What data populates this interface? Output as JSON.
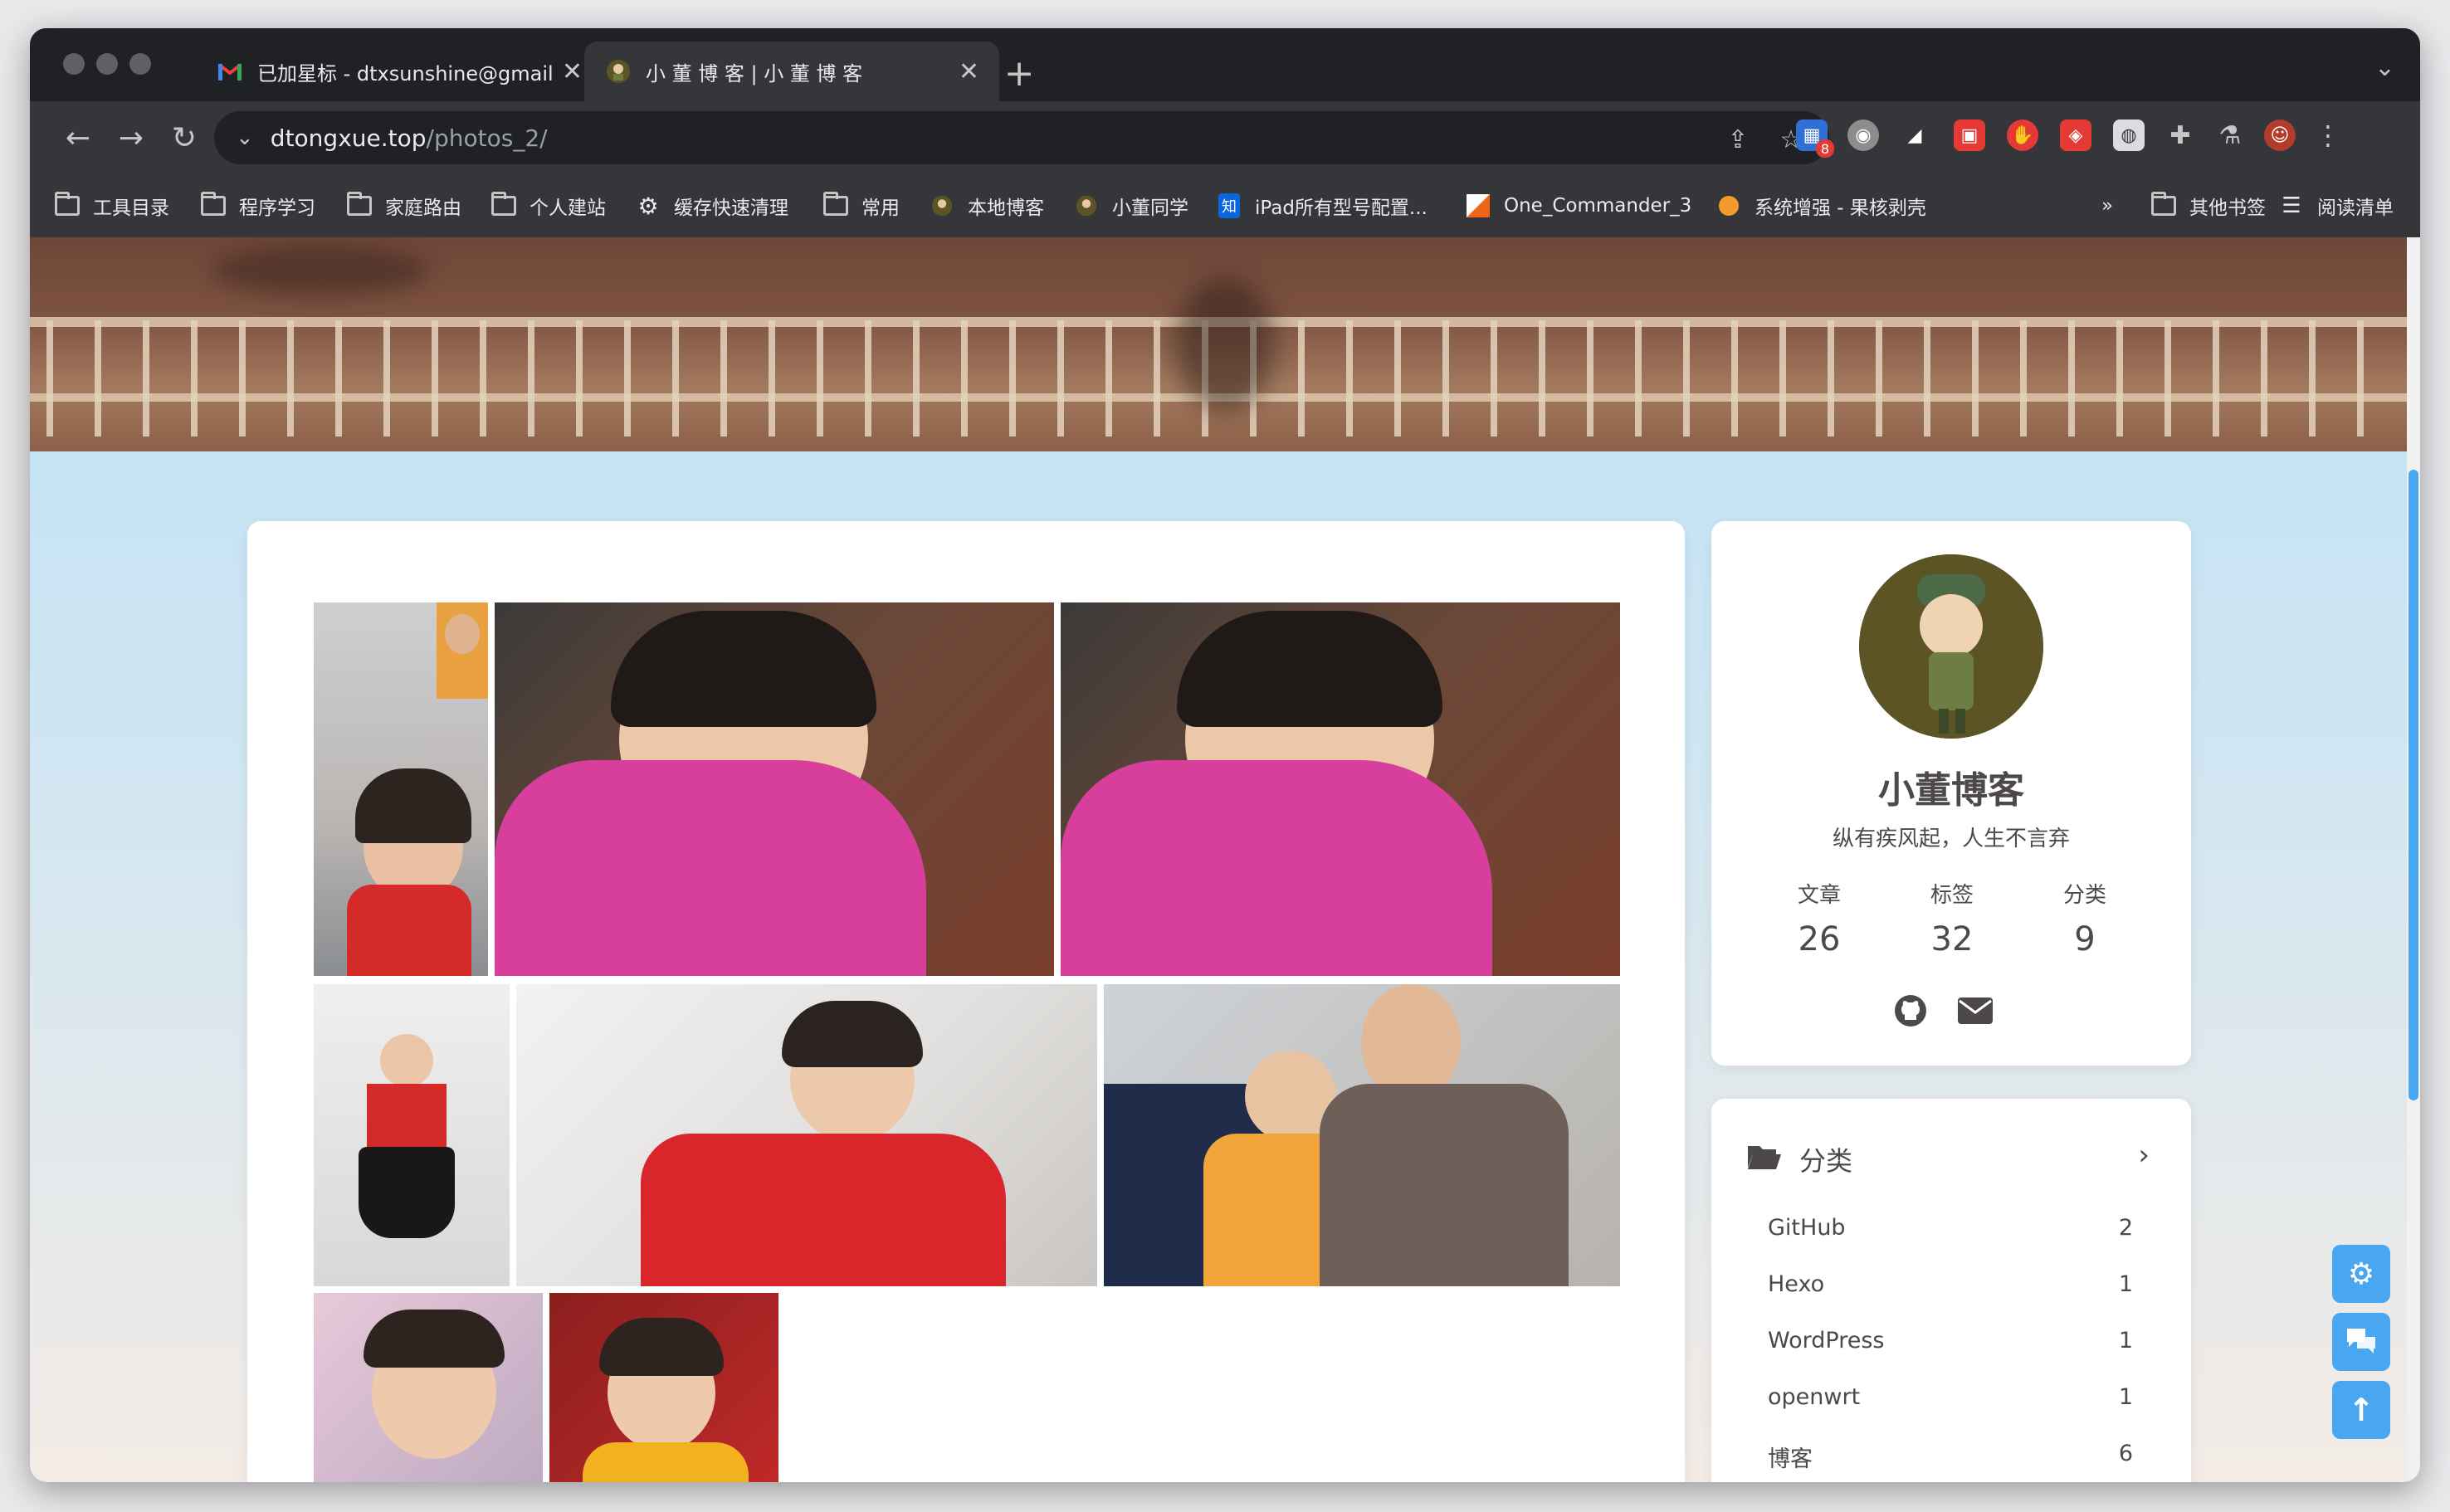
{
  "browser": {
    "tabs": [
      {
        "title": "已加星标 - dtxsunshine@gmail.",
        "favicon": "gmail-icon"
      },
      {
        "title": "小 董 博 客 | 小 董 博 客",
        "favicon": "site-favicon"
      }
    ],
    "address": {
      "domain": "dtongxue.top",
      "path": "/photos_2/"
    },
    "extension_badge": "8",
    "bookmarks": [
      {
        "label": "工具目录",
        "icon": "folder-icon"
      },
      {
        "label": "程序学习",
        "icon": "folder-icon"
      },
      {
        "label": "家庭路由",
        "icon": "folder-icon"
      },
      {
        "label": "个人建站",
        "icon": "folder-icon"
      },
      {
        "label": "缓存快速清理",
        "icon": "gear-icon"
      },
      {
        "label": "常用",
        "icon": "folder-icon"
      },
      {
        "label": "本地博客",
        "icon": "site-favicon"
      },
      {
        "label": "小董同学",
        "icon": "site-favicon"
      },
      {
        "label": "iPad所有型号配置...",
        "icon": "zhihu-icon"
      },
      {
        "label": "One_Commander_3",
        "icon": "commander-icon"
      },
      {
        "label": "系统增强 - 果核剥壳",
        "icon": "orange-icon"
      }
    ],
    "bookmarks_overflow": "»",
    "other_bookmarks": "其他书签",
    "reading_list": "阅读清单",
    "zhihu_glyph": "知"
  },
  "profile": {
    "name": "小董博客",
    "motto": "纵有疾风起，人生不言弃",
    "stats": [
      {
        "label": "文章",
        "value": "26"
      },
      {
        "label": "标签",
        "value": "32"
      },
      {
        "label": "分类",
        "value": "9"
      }
    ]
  },
  "categories": {
    "title": "分类",
    "items": [
      {
        "name": "GitHub",
        "count": "2"
      },
      {
        "name": "Hexo",
        "count": "1"
      },
      {
        "name": "WordPress",
        "count": "1"
      },
      {
        "name": "openwrt",
        "count": "1"
      },
      {
        "name": "博客",
        "count": "6"
      }
    ]
  },
  "colors": {
    "accent": "#49a6f0",
    "text": "#4c4948",
    "browser_frame": "#35363a"
  }
}
